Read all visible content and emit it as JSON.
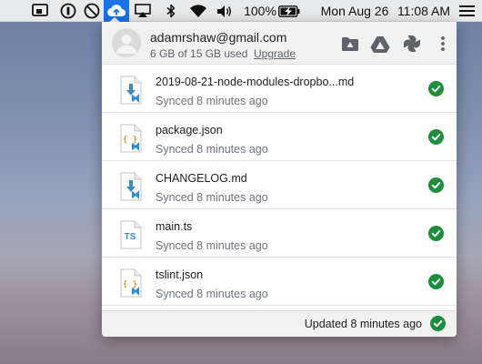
{
  "menubar": {
    "battery_percent": "100%",
    "date": "Mon Aug 26",
    "time": "11:08 AM",
    "icons": [
      "airplay-monitor-icon",
      "1password-icon",
      "no-entry-icon",
      "backup-sync-cloud-icon",
      "airplay-icon",
      "bluetooth-icon",
      "wifi-icon",
      "volume-icon",
      "battery-charging-icon"
    ]
  },
  "account": {
    "email": "adamrshaw@gmail.com",
    "quota": "6 GB of 15 GB used",
    "upgrade_label": "Upgrade"
  },
  "header_actions": [
    "open-folder-icon",
    "google-drive-icon",
    "google-photos-icon",
    "more-options-icon"
  ],
  "files": [
    {
      "name": "2019-08-21-node-modules-dropbo...md",
      "status": "Synced 8 minutes ago",
      "icon": "markdown-file-icon"
    },
    {
      "name": "package.json",
      "status": "Synced 8 minutes ago",
      "icon": "json-file-icon"
    },
    {
      "name": "CHANGELOG.md",
      "status": "Synced 8 minutes ago",
      "icon": "markdown-file-icon"
    },
    {
      "name": "main.ts",
      "status": "Synced 8 minutes ago",
      "icon": "typescript-file-icon",
      "icon_text": "TS"
    },
    {
      "name": "tslint.json",
      "status": "Synced 8 minutes ago",
      "icon": "json-file-icon"
    }
  ],
  "footer": {
    "status": "Updated 8 minutes ago"
  },
  "colors": {
    "sync_green": "#1e8e3e",
    "active_blue": "#1a73e8",
    "json_yellow": "#c5a22e",
    "vscode_blue": "#2b8fd6",
    "md_arrow": "#3b8fb8"
  }
}
